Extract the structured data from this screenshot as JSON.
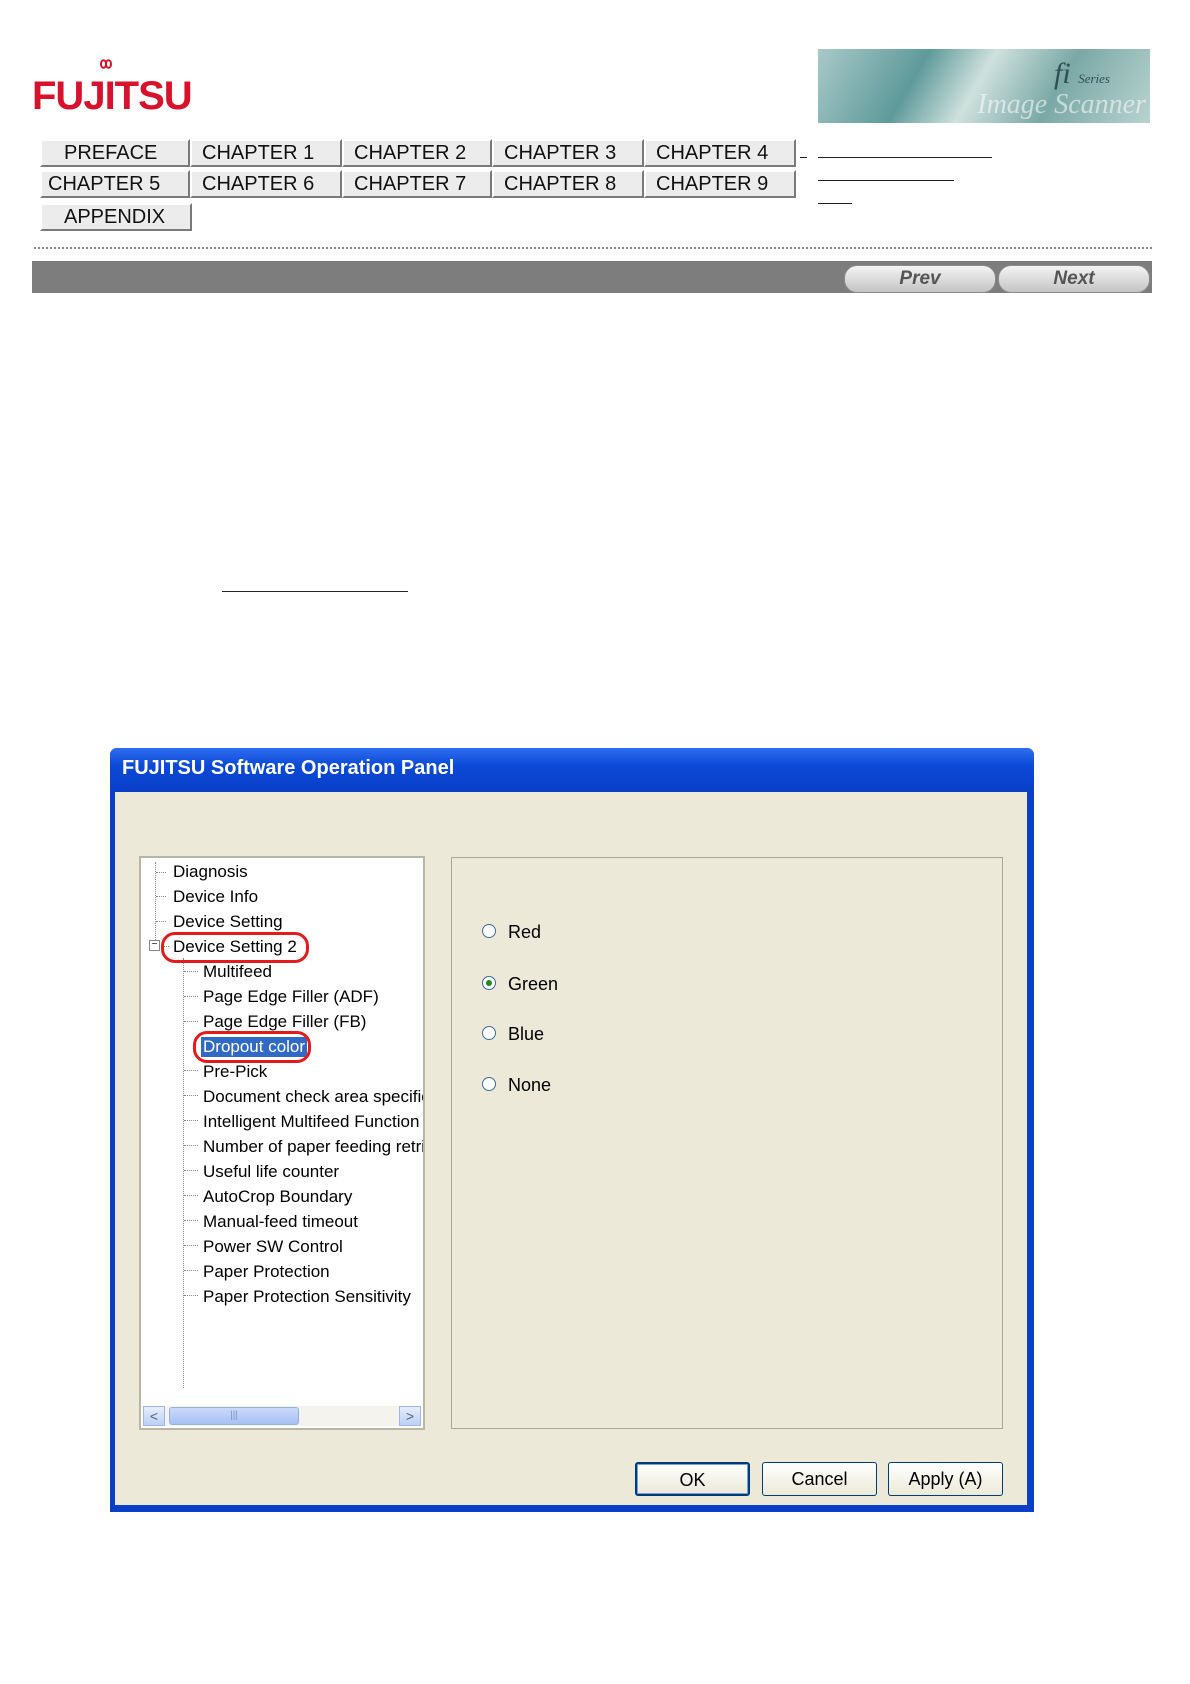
{
  "brand": {
    "logo_text": "FUJITSU",
    "banner_fi": "fi",
    "banner_series": "Series",
    "banner_ghost": "Image Scanner"
  },
  "nav": {
    "buttons": [
      "PREFACE",
      "CHAPTER 1",
      "CHAPTER 2",
      "CHAPTER 3",
      "CHAPTER 4",
      "CHAPTER 5",
      "CHAPTER 6",
      "CHAPTER 7",
      "CHAPTER 8",
      "CHAPTER 9",
      "APPENDIX"
    ]
  },
  "pager": {
    "prev": "Prev",
    "next": "Next"
  },
  "dialog": {
    "title": "FUJITSU Software Operation Panel",
    "tree": {
      "items": [
        "Diagnosis",
        "Device Info",
        "Device Setting",
        "Device Setting 2",
        "Multifeed",
        "Page Edge Filler (ADF)",
        "Page Edge Filler (FB)",
        "Dropout color",
        "Pre-Pick",
        "Document check area specific",
        "Intelligent Multifeed Function",
        "Number of paper feeding retrie",
        "Useful life counter",
        "AutoCrop Boundary",
        "Manual-feed timeout",
        "Power SW Control",
        "Paper Protection",
        "Paper Protection Sensitivity"
      ],
      "selected": "Dropout color",
      "expander": "−"
    },
    "options": [
      {
        "label": "Red",
        "checked": false
      },
      {
        "label": "Green",
        "checked": true
      },
      {
        "label": "Blue",
        "checked": false
      },
      {
        "label": "None",
        "checked": false
      }
    ],
    "buttons": {
      "ok": "OK",
      "cancel": "Cancel",
      "apply": "Apply (A)"
    },
    "scroll": {
      "left": "<",
      "right": ">",
      "grip": "|||"
    }
  }
}
